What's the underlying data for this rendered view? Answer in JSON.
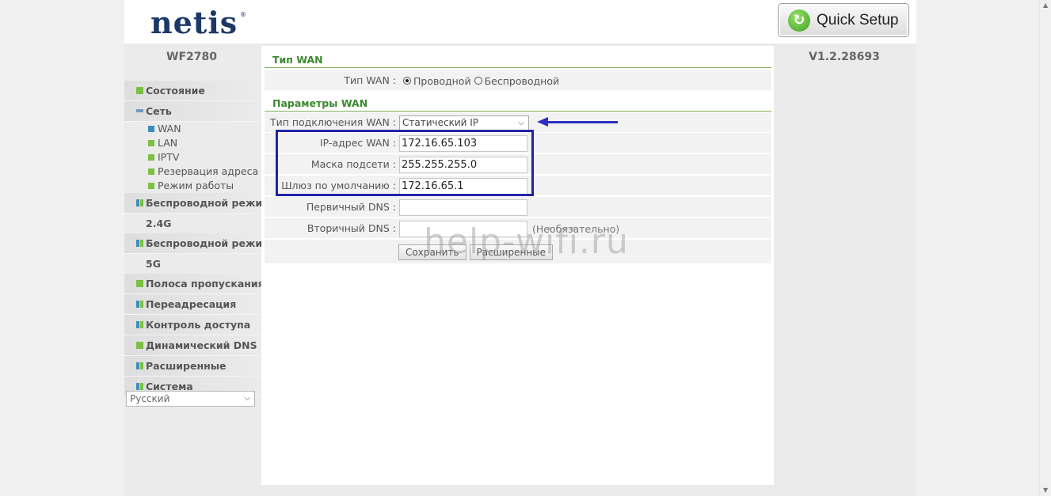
{
  "header": {
    "logo_text": "netis",
    "logo_reg": "®",
    "quick_setup_label": "Quick Setup",
    "model": "WF2780",
    "version": "V1.2.28693"
  },
  "sidebar": {
    "items": [
      {
        "label": "Состояние"
      },
      {
        "label": "Сеть"
      },
      {
        "label": "WAN"
      },
      {
        "label": "LAN"
      },
      {
        "label": "IPTV"
      },
      {
        "label": "Резервация адреса"
      },
      {
        "label": "Режим работы"
      },
      {
        "label": "Беспроводной режим"
      },
      {
        "label": "2.4G"
      },
      {
        "label": "Беспроводной режим"
      },
      {
        "label": "5G"
      },
      {
        "label": "Полоса пропускания"
      },
      {
        "label": "Переадресация"
      },
      {
        "label": "Контроль доступа"
      },
      {
        "label": "Динамический DNS"
      },
      {
        "label": "Расширенные"
      },
      {
        "label": "Система"
      }
    ],
    "language": "Русский"
  },
  "wan_type": {
    "section_title": "Тип WAN",
    "label": "Тип WAN :",
    "option_wired": "Проводной",
    "option_wireless": "Беспроводной",
    "selected": "Проводной"
  },
  "wan_params": {
    "section_title": "Параметры WAN",
    "connection_type_label": "Тип подключения WAN :",
    "connection_type_value": "Статический IP",
    "ip_label": "IP-адрес WAN :",
    "ip_value": "172.16.65.103",
    "mask_label": "Маска подсети :",
    "mask_value": "255.255.255.0",
    "gateway_label": "Шлюз по умолчанию :",
    "gateway_value": "172.16.65.1",
    "dns1_label": "Первичный DNS :",
    "dns1_value": "",
    "dns2_label": "Вторичный DNS :",
    "dns2_value": "",
    "optional_note": "(Необязательно)",
    "save_label": "Сохранить",
    "advanced_label": "Расширенные"
  },
  "watermark": "help-wifi.ru",
  "colors": {
    "accent_green": "#3a8a2e",
    "logo_blue": "#1c3866",
    "annotation_blue": "#1f24a8"
  }
}
